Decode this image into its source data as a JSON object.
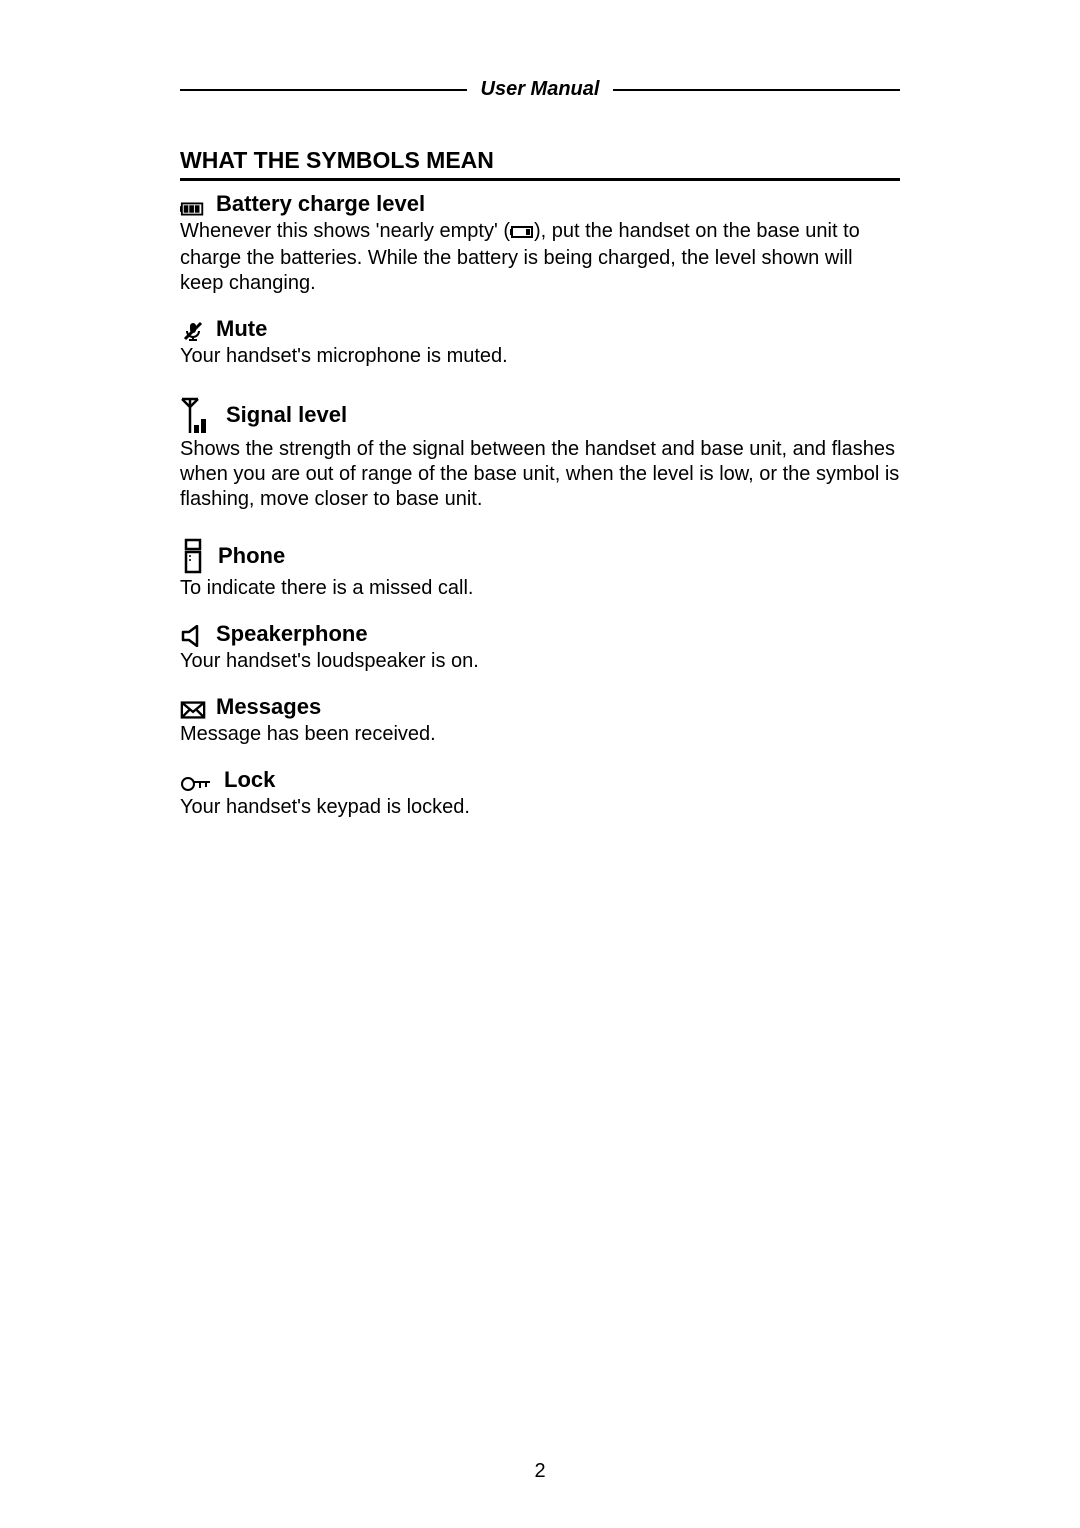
{
  "header": {
    "title": "User Manual"
  },
  "section_heading": "WHAT THE SYMBOLS MEAN",
  "symbols": {
    "battery": {
      "name": "Battery charge level",
      "desc_a": "Whenever this shows 'nearly empty' (",
      "desc_b": "), put the handset on the base unit to charge the batteries. While the battery is being charged, the level shown will keep changing."
    },
    "mute": {
      "name": "Mute",
      "desc": "Your handset's microphone is muted."
    },
    "signal": {
      "name": "Signal level",
      "desc": "Shows the strength of the signal between the handset and base unit, and flashes when you are out of range of the base unit, when the level is low, or the symbol is flashing, move closer to base unit."
    },
    "phone": {
      "name": "Phone",
      "desc": "To indicate there is a missed call."
    },
    "speaker": {
      "name": "Speakerphone",
      "desc": "Your handset's loudspeaker is on."
    },
    "messages": {
      "name": "Messages",
      "desc": "Message has been received."
    },
    "lock": {
      "name": "Lock",
      "desc": "Your handset's keypad is locked."
    }
  },
  "page_number": "2"
}
